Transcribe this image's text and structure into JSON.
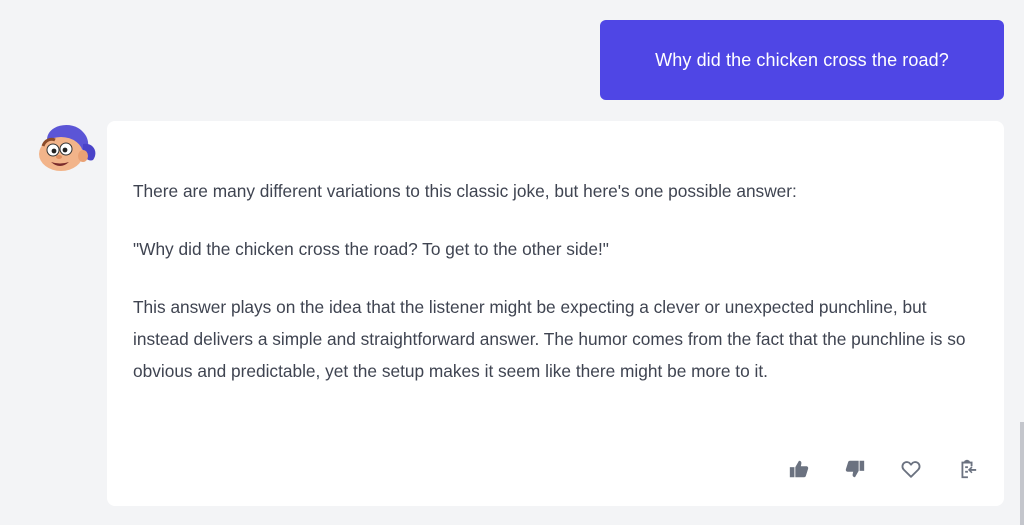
{
  "conversation": {
    "user_message": "Why did the chicken cross the road?",
    "assistant": {
      "avatar_icon": "cartoon-boy-avatar-icon",
      "paragraphs": [
        "There are many different variations to this classic joke, but here's one possible answer:",
        "\"Why did the chicken cross the road? To get to the other side!\"",
        "This answer plays on the idea that the listener might be expecting a clever or unexpected punchline, but instead delivers a simple and straightforward answer. The humor comes from the fact that the punchline is so obvious and predictable, yet the setup makes it seem like there might be more to it."
      ],
      "actions": [
        "thumbs-up-icon",
        "thumbs-down-icon",
        "heart-icon",
        "clipboard-icon"
      ]
    }
  },
  "colors": {
    "background": "#f3f4f6",
    "user_bubble": "#4f46e5",
    "card": "#ffffff",
    "text": "#3f4451",
    "icon": "#6b7280"
  }
}
